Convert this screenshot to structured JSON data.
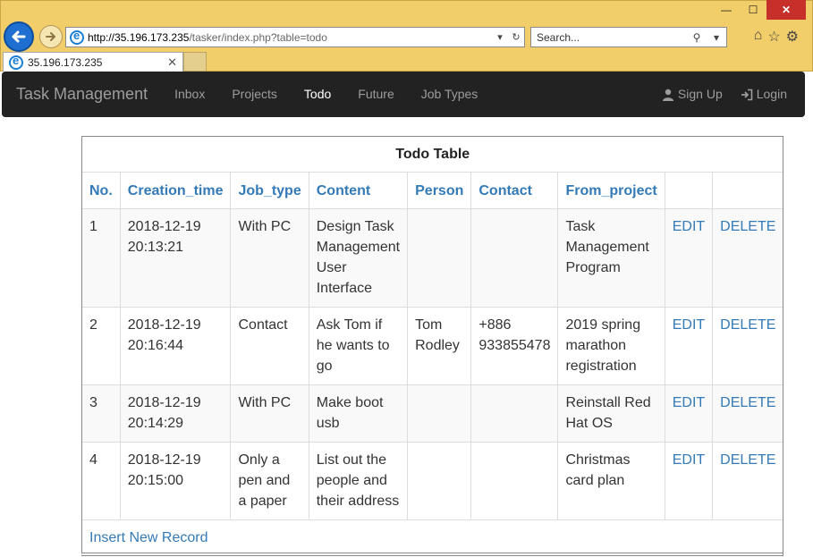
{
  "browser": {
    "url_host": "http://35.196.173.235",
    "url_path": "/tasker/index.php?table=todo",
    "search_placeholder": "Search...",
    "tab_title": "35.196.173.235",
    "win_minimize": "—",
    "win_maximize": "☐",
    "win_close": "✕"
  },
  "navbar": {
    "brand": "Task Management",
    "links": [
      "Inbox",
      "Projects",
      "Todo",
      "Future",
      "Job Types"
    ],
    "active": "Todo",
    "signup": "Sign Up",
    "login": "Login"
  },
  "table": {
    "title": "Todo Table",
    "columns": [
      "No.",
      "Creation_time",
      "Job_type",
      "Content",
      "Person",
      "Contact",
      "From_project",
      "",
      ""
    ],
    "rows": [
      {
        "no": "1",
        "time_date": "2018-12-19",
        "time_clock": "20:13:21",
        "job_type": "With PC",
        "content": "Design Task Management User Interface",
        "person": "",
        "contact": "",
        "from_project": "Task Management Program",
        "edit": "EDIT",
        "delete": "DELETE"
      },
      {
        "no": "2",
        "time_date": "2018-12-19",
        "time_clock": "20:16:44",
        "job_type": "Contact",
        "content": "Ask Tom if he wants to go",
        "person": "Tom Rodley",
        "contact": "+886 933855478",
        "from_project": "2019 spring marathon registration",
        "edit": "EDIT",
        "delete": "DELETE"
      },
      {
        "no": "3",
        "time_date": "2018-12-19",
        "time_clock": "20:14:29",
        "job_type": "With PC",
        "content": "Make boot usb",
        "person": "",
        "contact": "",
        "from_project": "Reinstall Red Hat OS",
        "edit": "EDIT",
        "delete": "DELETE"
      },
      {
        "no": "4",
        "time_date": "2018-12-19",
        "time_clock": "20:15:00",
        "job_type": "Only a pen and a paper",
        "content": "List out the people and their address",
        "person": "",
        "contact": "",
        "from_project": "Christmas card plan",
        "edit": "EDIT",
        "delete": "DELETE"
      }
    ],
    "insert_label": "Insert New Record"
  },
  "colors": {
    "navbar_bg": "#222222",
    "link": "#337ab7",
    "chrome": "#f2ce6a"
  }
}
